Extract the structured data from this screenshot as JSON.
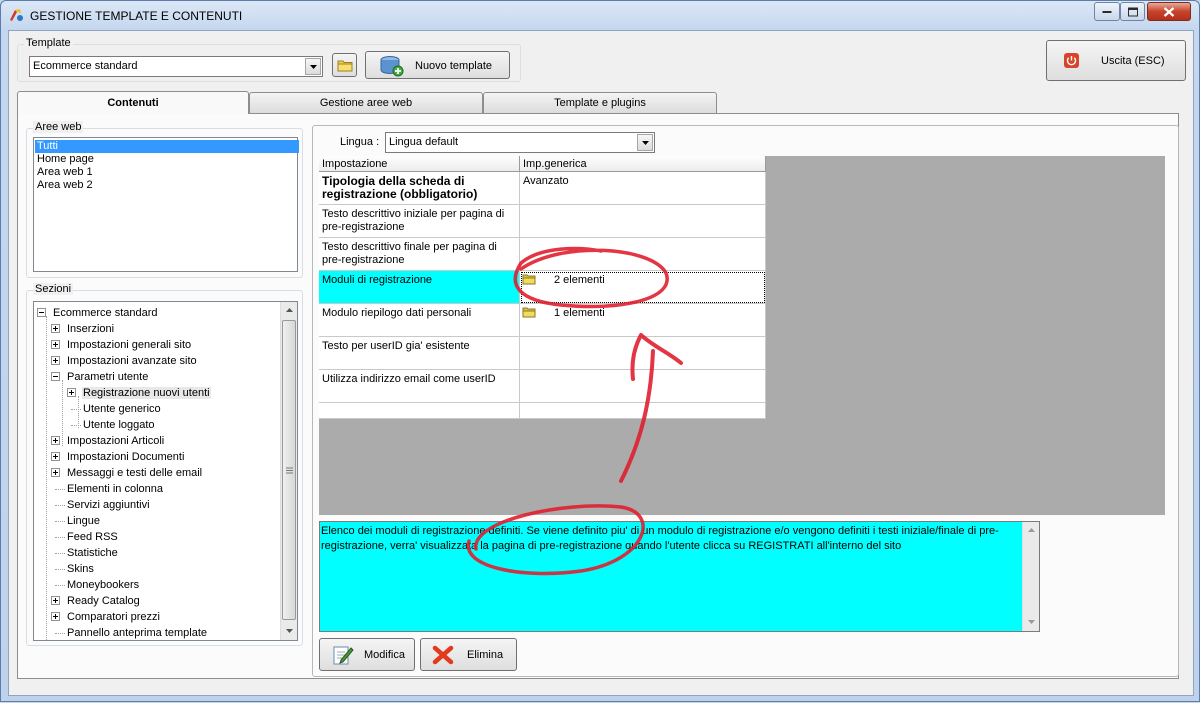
{
  "window": {
    "title": "GESTIONE TEMPLATE E CONTENUTI"
  },
  "template_group": {
    "label": "Template",
    "selected": "Ecommerce standard",
    "new_button": "Nuovo template"
  },
  "exit_button": "Uscita (ESC)",
  "tabs": [
    {
      "label": "Contenuti",
      "active": true
    },
    {
      "label": "Gestione aree web",
      "active": false
    },
    {
      "label": "Template e plugins",
      "active": false
    }
  ],
  "aree_web": {
    "label": "Aree web",
    "items": [
      "Tutti",
      "Home page",
      "Area web 1",
      "Area web 2"
    ],
    "selected_index": 0
  },
  "sezioni": {
    "label": "Sezioni",
    "tree": [
      {
        "label": "Ecommerce standard",
        "level": 0,
        "expander": "minus"
      },
      {
        "label": "Inserzioni",
        "level": 1,
        "expander": "plus"
      },
      {
        "label": "Impostazioni generali sito",
        "level": 1,
        "expander": "plus"
      },
      {
        "label": "Impostazioni avanzate sito",
        "level": 1,
        "expander": "plus"
      },
      {
        "label": "Parametri utente",
        "level": 1,
        "expander": "minus"
      },
      {
        "label": "Registrazione nuovi utenti",
        "level": 2,
        "expander": "plus",
        "selected": true
      },
      {
        "label": "Utente generico",
        "level": 2,
        "expander": "none"
      },
      {
        "label": "Utente loggato",
        "level": 2,
        "expander": "none"
      },
      {
        "label": "Impostazioni Articoli",
        "level": 1,
        "expander": "plus"
      },
      {
        "label": "Impostazioni Documenti",
        "level": 1,
        "expander": "plus"
      },
      {
        "label": "Messaggi e testi delle email",
        "level": 1,
        "expander": "plus"
      },
      {
        "label": "Elementi in colonna",
        "level": 1,
        "expander": "none"
      },
      {
        "label": "Servizi aggiuntivi",
        "level": 1,
        "expander": "none"
      },
      {
        "label": "Lingue",
        "level": 1,
        "expander": "none"
      },
      {
        "label": "Feed RSS",
        "level": 1,
        "expander": "none"
      },
      {
        "label": "Statistiche",
        "level": 1,
        "expander": "none"
      },
      {
        "label": "Skins",
        "level": 1,
        "expander": "none"
      },
      {
        "label": "Moneybookers",
        "level": 1,
        "expander": "none"
      },
      {
        "label": "Ready Catalog",
        "level": 1,
        "expander": "plus"
      },
      {
        "label": "Comparatori prezzi",
        "level": 1,
        "expander": "plus"
      },
      {
        "label": "Pannello anteprima template",
        "level": 1,
        "expander": "none"
      }
    ]
  },
  "lingua": {
    "label": "Lingua :",
    "selected": "Lingua default"
  },
  "grid": {
    "headers": [
      "Impostazione",
      "Imp.generica"
    ],
    "rows": [
      {
        "name": "Tipologia della scheda di registrazione (obbligatorio)",
        "value": "Avanzato",
        "bold": true,
        "icon": false
      },
      {
        "name": "Testo descrittivo iniziale per pagina di pre-registrazione",
        "value": "",
        "bold": false,
        "icon": false
      },
      {
        "name": "Testo descrittivo finale per pagina di pre-registrazione",
        "value": "",
        "bold": false,
        "icon": false
      },
      {
        "name": "Moduli di registrazione",
        "value": "2 elementi",
        "bold": false,
        "icon": true,
        "selected": true
      },
      {
        "name": "Modulo riepilogo dati personali",
        "value": "1 elementi",
        "bold": false,
        "icon": true
      },
      {
        "name": "Testo per userID gia' esistente",
        "value": "",
        "bold": false,
        "icon": false
      },
      {
        "name": "Utilizza indirizzo email come userID",
        "value": "",
        "bold": false,
        "icon": false
      },
      {
        "name": "",
        "value": "",
        "bold": false,
        "icon": false
      }
    ]
  },
  "description": "Elenco dei moduli di registrazione definiti. Se viene definito piu' di un modulo di registrazione e/o vengono definiti i testi iniziale/finale di pre-registrazione, verra' visualizzata la pagina di pre-registrazione quando l'utente clicca su REGISTRATI all'interno del sito",
  "actions": {
    "modifica": "Modifica",
    "elimina": "Elimina"
  },
  "colors": {
    "highlight": "#00ffff",
    "selection": "#3399ff",
    "annotation": "#e02030"
  }
}
